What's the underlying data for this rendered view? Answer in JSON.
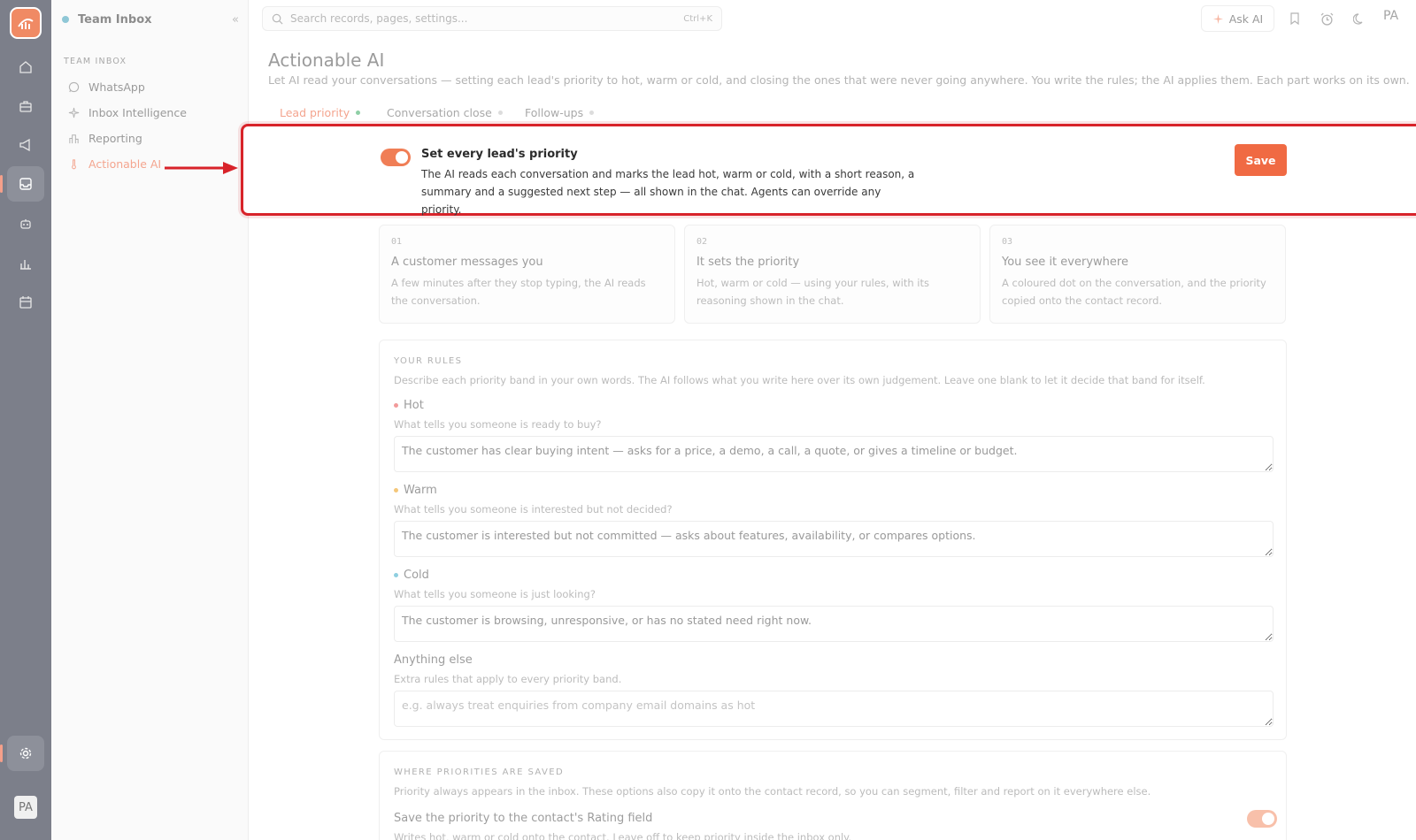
{
  "workspace": {
    "name": "Team Inbox",
    "section": "TEAM INBOX"
  },
  "sidebar": {
    "items": [
      {
        "label": "WhatsApp",
        "icon": "whatsapp-icon"
      },
      {
        "label": "Inbox Intelligence",
        "icon": "sparkle-icon"
      },
      {
        "label": "Reporting",
        "icon": "bar-chart-icon"
      },
      {
        "label": "Actionable AI",
        "icon": "thermometer-icon",
        "active": true
      }
    ]
  },
  "rail": {
    "icons": [
      "home-icon",
      "briefcase-icon",
      "megaphone-icon",
      "inbox-icon",
      "robot-icon",
      "chart-icon",
      "calendar-icon",
      "settings-icon"
    ],
    "avatar": "PA"
  },
  "topbar": {
    "search_placeholder": "Search records, pages, settings...",
    "search_shortcut": "Ctrl+K",
    "ask_ai": "Ask AI",
    "user_initials": "PA"
  },
  "page": {
    "title": "Actionable AI",
    "subtitle": "Let AI read your conversations — setting each lead's priority to hot, warm or cold, and closing the ones that were never going anywhere. You write the rules; the AI applies them. Each part works on its own."
  },
  "tabs": [
    {
      "label": "Lead priority",
      "active": true
    },
    {
      "label": "Conversation close",
      "active": false
    },
    {
      "label": "Follow-ups",
      "active": false
    }
  ],
  "priority_setting": {
    "enabled": true,
    "title": "Set every lead's priority",
    "description": "The AI reads each conversation and marks the lead hot, warm or cold, with a short reason, a summary and a suggested next step — all shown in the chat. Agents can override any priority.",
    "save_label": "Save"
  },
  "steps": [
    {
      "num": "01",
      "title": "A customer messages you",
      "desc": "A few minutes after they stop typing, the AI reads the conversation."
    },
    {
      "num": "02",
      "title": "It sets the priority",
      "desc": "Hot, warm or cold — using your rules, with its reasoning shown in the chat."
    },
    {
      "num": "03",
      "title": "You see it everywhere",
      "desc": "A coloured dot on the conversation, and the priority copied onto the contact record."
    }
  ],
  "rules": {
    "caption": "YOUR RULES",
    "description": "Describe each priority band in your own words. The AI follows what you write here over its own judgement. Leave one blank to let it decide that band for itself.",
    "bands": [
      {
        "label": "Hot",
        "color": "#f29a9a",
        "hint": "What tells you someone is ready to buy?",
        "value": "The customer has clear buying intent — asks for a price, a demo, a call, a quote, or gives a timeline or budget."
      },
      {
        "label": "Warm",
        "color": "#f4c77a",
        "hint": "What tells you someone is interested but not decided?",
        "value": "The customer is interested but not committed — asks about features, availability, or compares options."
      },
      {
        "label": "Cold",
        "color": "#8fcfe0",
        "hint": "What tells you someone is just looking?",
        "value": "The customer is browsing, unresponsive, or has no stated need right now."
      }
    ],
    "extra": {
      "label": "Anything else",
      "hint": "Extra rules that apply to every priority band.",
      "placeholder": "e.g. always treat enquiries from company email domains as hot"
    }
  },
  "saved": {
    "caption": "WHERE PRIORITIES ARE SAVED",
    "description": "Priority always appears in the inbox. These options also copy it onto the contact record, so you can segment, filter and report on it everywhere else.",
    "option_title": "Save the priority to the contact's Rating field",
    "option_desc": "Writes hot, warm or cold onto the contact. Leave off to keep priority inside the inbox only.",
    "option_enabled": true
  },
  "colors": {
    "accent": "#f06a43",
    "highlight": "#d8232a",
    "rail": "#7c7f8a"
  }
}
